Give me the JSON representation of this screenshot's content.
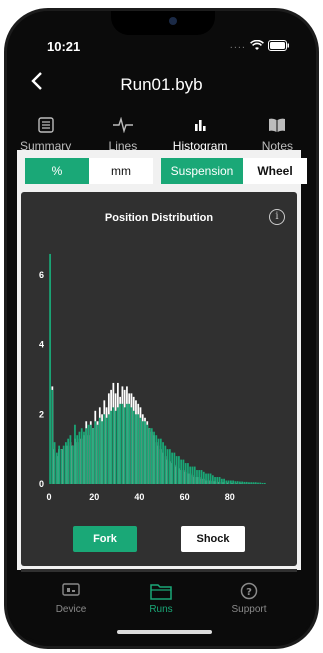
{
  "status": {
    "time": "10:21"
  },
  "header": {
    "title": "Run01.byb"
  },
  "tabs": [
    {
      "label": "Summary",
      "icon": "list-icon"
    },
    {
      "label": "Lines",
      "icon": "pulse-icon"
    },
    {
      "label": "Histogram",
      "icon": "bar-chart-icon",
      "active": true
    },
    {
      "label": "Notes",
      "icon": "book-icon"
    }
  ],
  "units": {
    "percent": "%",
    "mm": "mm"
  },
  "mode": {
    "suspension": "Suspension",
    "wheel": "Wheel"
  },
  "card": {
    "title": "Position Distribution"
  },
  "chart_data": {
    "type": "bar",
    "title": "Position Distribution",
    "xlabel": "",
    "ylabel": "",
    "xlim": [
      0,
      100
    ],
    "ylim": [
      0,
      7
    ],
    "x_ticks": [
      0,
      20,
      40,
      60,
      80
    ],
    "y_ticks": [
      0,
      2,
      4,
      6
    ],
    "series": [
      {
        "name": "Fork",
        "color": "#1aa877",
        "x": [
          0,
          1,
          2,
          3,
          4,
          5,
          6,
          7,
          8,
          9,
          10,
          11,
          12,
          13,
          14,
          15,
          16,
          17,
          18,
          19,
          20,
          21,
          22,
          23,
          24,
          25,
          26,
          27,
          28,
          29,
          30,
          31,
          32,
          33,
          34,
          35,
          36,
          37,
          38,
          39,
          40,
          41,
          42,
          43,
          44,
          45,
          46,
          47,
          48,
          49,
          50,
          51,
          52,
          53,
          54,
          55,
          56,
          57,
          58,
          59,
          60,
          61,
          62,
          63,
          64,
          65,
          66,
          67,
          68,
          69,
          70,
          71,
          72,
          73,
          74,
          75,
          76,
          77,
          78,
          79,
          80,
          81,
          82,
          83,
          84,
          85,
          86,
          87,
          88,
          89,
          90,
          91,
          92,
          93,
          94,
          95
        ],
        "values": [
          6.6,
          2.7,
          1.2,
          0.9,
          1.1,
          1.0,
          1.1,
          1.2,
          1.3,
          1.4,
          1.1,
          1.7,
          1.4,
          1.5,
          1.6,
          1.5,
          1.6,
          1.7,
          1.7,
          1.6,
          1.8,
          1.7,
          1.9,
          1.8,
          2.0,
          1.9,
          2.0,
          2.1,
          2.2,
          2.1,
          2.2,
          2.3,
          2.3,
          2.2,
          2.3,
          2.3,
          2.2,
          2.1,
          2.0,
          2.0,
          1.9,
          1.8,
          1.8,
          1.7,
          1.6,
          1.6,
          1.5,
          1.4,
          1.3,
          1.3,
          1.2,
          1.1,
          1.0,
          1.0,
          0.9,
          0.9,
          0.8,
          0.8,
          0.7,
          0.7,
          0.6,
          0.6,
          0.5,
          0.5,
          0.5,
          0.4,
          0.4,
          0.4,
          0.35,
          0.3,
          0.3,
          0.3,
          0.25,
          0.2,
          0.2,
          0.2,
          0.15,
          0.15,
          0.1,
          0.1,
          0.1,
          0.1,
          0.08,
          0.08,
          0.07,
          0.07,
          0.06,
          0.06,
          0.05,
          0.05,
          0.05,
          0.05,
          0.04,
          0.04,
          0.03,
          0.03
        ]
      },
      {
        "name": "Shock",
        "color": "#ffffff",
        "x": [
          0,
          1,
          2,
          3,
          4,
          5,
          6,
          7,
          8,
          9,
          10,
          11,
          12,
          13,
          14,
          15,
          16,
          17,
          18,
          19,
          20,
          21,
          22,
          23,
          24,
          25,
          26,
          27,
          28,
          29,
          30,
          31,
          32,
          33,
          34,
          35,
          36,
          37,
          38,
          39,
          40,
          41,
          42,
          43,
          44,
          45,
          46,
          47,
          48,
          49,
          50,
          51,
          52,
          53,
          54,
          55,
          56,
          57,
          58,
          59,
          60,
          61,
          62,
          63,
          64,
          65,
          66,
          67,
          68,
          69,
          70,
          71,
          72,
          73,
          74,
          75,
          76,
          77,
          78,
          79,
          80,
          81,
          82,
          83,
          84,
          85,
          86,
          87,
          88,
          89,
          90,
          91,
          92,
          93,
          94,
          95
        ],
        "values": [
          0,
          2.8,
          1.0,
          0.8,
          1.0,
          1.0,
          1.0,
          1.1,
          1.1,
          1.2,
          1.1,
          1.3,
          1.2,
          1.3,
          1.3,
          1.4,
          1.8,
          1.4,
          1.8,
          1.6,
          2.1,
          1.8,
          2.2,
          2.0,
          2.4,
          2.2,
          2.6,
          2.7,
          2.9,
          2.6,
          2.9,
          2.5,
          2.8,
          2.7,
          2.8,
          2.6,
          2.6,
          2.5,
          2.4,
          2.3,
          2.2,
          2.0,
          1.9,
          1.8,
          1.6,
          1.5,
          1.4,
          1.2,
          1.1,
          1.0,
          0.9,
          0.8,
          0.7,
          0.65,
          0.6,
          0.55,
          0.5,
          0.45,
          0.4,
          0.4,
          0.35,
          0.3,
          0.3,
          0.25,
          0.2,
          0.2,
          0.2,
          0.15,
          0.15,
          0.1,
          0.1,
          0.1,
          0.08,
          0.08,
          0.06,
          0.06,
          0.05,
          0.05,
          0.04,
          0.04,
          0.03,
          0.03,
          0.02,
          0.02,
          0.02,
          0.02,
          0.01,
          0.01,
          0.01,
          0.01,
          0.01,
          0.01,
          0,
          0,
          0,
          0
        ]
      }
    ]
  },
  "legend": {
    "fork": "Fork",
    "shock": "Shock"
  },
  "nav": [
    {
      "label": "Device",
      "icon": "device-icon"
    },
    {
      "label": "Runs",
      "icon": "folder-icon",
      "active": true
    },
    {
      "label": "Support",
      "icon": "help-icon"
    }
  ],
  "colors": {
    "accent": "#1aa877",
    "card": "#303030"
  }
}
